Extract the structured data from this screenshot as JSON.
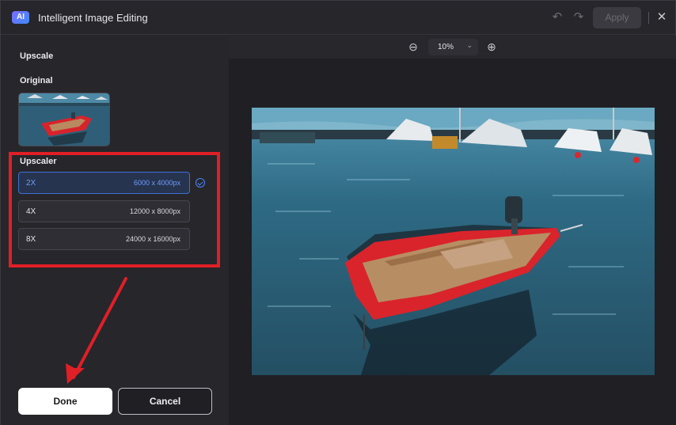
{
  "titlebar": {
    "logo_text": "AI",
    "title": "Intelligent Image Editing",
    "undo_icon": "undo-icon",
    "redo_icon": "redo-icon",
    "apply_label": "Apply",
    "close_icon": "close-icon"
  },
  "sidebar": {
    "upscale_title": "Upscale",
    "original_title": "Original",
    "upscaler_title": "Upscaler",
    "options": [
      {
        "label": "2X",
        "size": "6000 x 4000px",
        "selected": true
      },
      {
        "label": "4X",
        "size": "12000 x 8000px",
        "selected": false
      },
      {
        "label": "8X",
        "size": "24000 x 16000px",
        "selected": false
      }
    ],
    "done_label": "Done",
    "cancel_label": "Cancel"
  },
  "viewer": {
    "zoom_out_icon": "zoom-out-icon",
    "zoom_value": "10%",
    "zoom_in_icon": "zoom-in-icon"
  },
  "colors": {
    "accent": "#3f6fd6",
    "highlight_annotation": "#e01f26",
    "background": "#26262b"
  }
}
